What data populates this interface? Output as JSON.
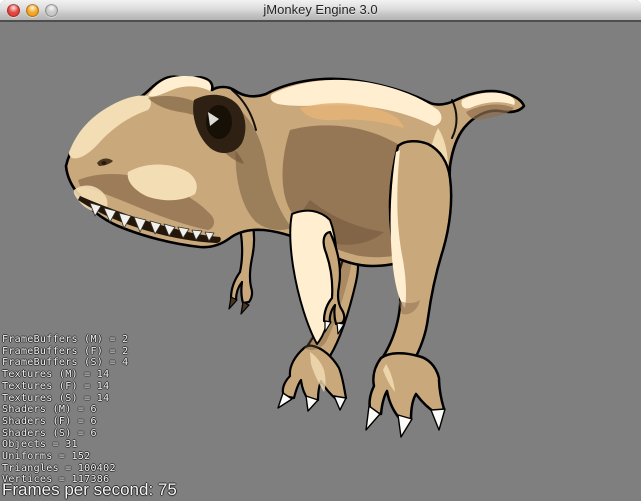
{
  "window": {
    "title": "jMonkey Engine 3.0",
    "controls": [
      {
        "name": "close",
        "color": "#e5433c"
      },
      {
        "name": "minimize",
        "color": "#f5a623"
      },
      {
        "name": "zoom",
        "color": "#c9c9c9"
      }
    ]
  },
  "scene": {
    "description": "Cel-shaded T-Rex 3D model on gray background",
    "colors": {
      "bg": "#7f7f7f",
      "outline": "#000000",
      "base": "#c9a87c",
      "cream": "#f3ddb4",
      "bright": "#ffeecf",
      "gold": "#e3b277",
      "brown": "#8d6e4f",
      "dark": "#6d5337",
      "deep": "#4a3621",
      "eye": "#171007",
      "socket": "#2e2113",
      "teeth": "#f2f0ea",
      "claw": "#fbfbf8",
      "mouth": "#241709"
    }
  },
  "stats": {
    "lines": [
      "FrameBuffers (M) = 2",
      "FrameBuffers (F) = 2",
      "FrameBuffers (S) = 4",
      "Textures (M) = 14",
      "Textures (F) = 14",
      "Textures (S) = 14",
      "Shaders (M) = 6",
      "Shaders (F) = 6",
      "Shaders (S) = 6",
      "Objects = 31",
      "Uniforms = 152",
      "Triangles = 100402",
      "Vertices = 117386"
    ]
  },
  "fps": {
    "text": "Frames per second: 75"
  }
}
